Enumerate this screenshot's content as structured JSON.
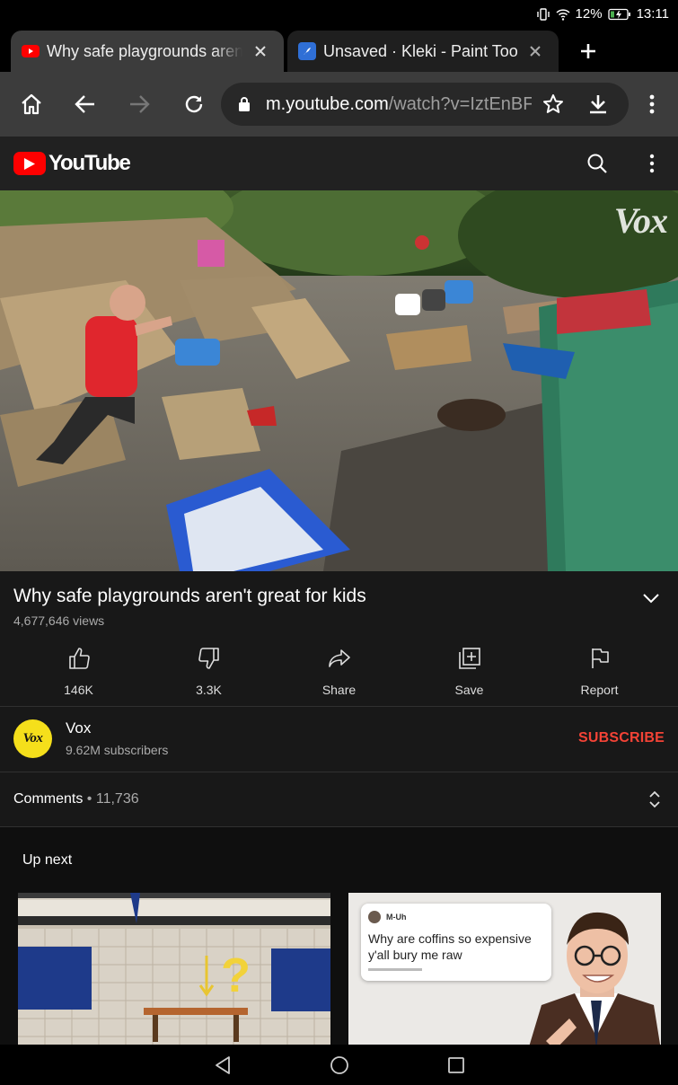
{
  "status_bar": {
    "battery": "12%",
    "time": "13:11"
  },
  "tabs": [
    {
      "title": "Why safe playgrounds aren't great for kids",
      "favicon": "youtube-favicon",
      "active": true
    },
    {
      "title": "Unsaved · Kleki - Paint Tool",
      "favicon": "kleki-favicon",
      "active": false
    }
  ],
  "toolbar": {
    "url_host": "m.youtube.com",
    "url_path": "/watch?v=IztEnBF"
  },
  "header": {
    "logo_text": "YouTube"
  },
  "video": {
    "watermark": "Vox"
  },
  "video_info": {
    "title": "Why safe playgrounds aren't great for kids",
    "views": "4,677,646 views"
  },
  "actions": [
    {
      "icon": "thumbs-up-icon",
      "label": "146K"
    },
    {
      "icon": "thumbs-down-icon",
      "label": "3.3K"
    },
    {
      "icon": "share-icon",
      "label": "Share"
    },
    {
      "icon": "save-playlist-icon",
      "label": "Save"
    },
    {
      "icon": "flag-icon",
      "label": "Report"
    }
  ],
  "channel": {
    "avatar_text": "Vox",
    "name": "Vox",
    "subscribers": "9.62M subscribers",
    "subscribe_label": "SUBSCRIBE"
  },
  "comments": {
    "label": "Comments",
    "separator": " • ",
    "count": "11,736"
  },
  "up_next": {
    "label": "Up next",
    "thumb2_tweet": {
      "name": "M-Uh",
      "text": "Why are coffins so expensive y'all bury me raw"
    }
  },
  "colors": {
    "accent": "#ff0000",
    "subscribe": "#f44336",
    "background": "#0f0f0f"
  }
}
